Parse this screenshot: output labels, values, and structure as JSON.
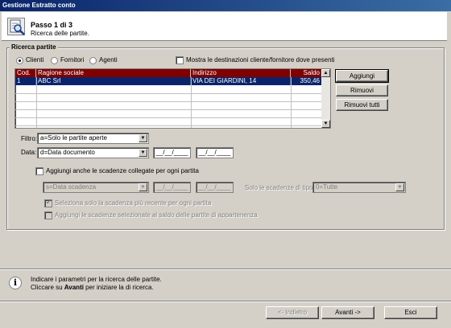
{
  "window": {
    "title": "Gestione Estratto conto"
  },
  "header": {
    "step": "Passo 1 di 3",
    "subtitle": "Ricerca delle partite.",
    "icon": "search-document-icon"
  },
  "group": {
    "title": "Ricerca partite"
  },
  "radios": {
    "clienti": "Clienti",
    "fornitori": "Fornitori",
    "agenti": "Agenti",
    "selected": "Clienti"
  },
  "checkbox_destinazioni": {
    "label": "Mostra le destinazioni cliente/fornitore dove presenti",
    "checked": false
  },
  "table": {
    "columns": [
      "Cod.",
      "Ragione sociale",
      "Indirizzo",
      "Saldo"
    ],
    "rows": [
      {
        "cod": "1",
        "ragione": "ABC Srl",
        "indirizzo": "VIA DEI GIARDINI, 14",
        "saldo": "350,46",
        "selected": true
      }
    ]
  },
  "buttons": {
    "aggiungi": "Aggiungi",
    "rimuovi": "Rimuovi",
    "rimuovi_tutti": "Rimuovi tutti"
  },
  "filtro": {
    "label": "Filtro:",
    "value": "a=Solo le partite aperte"
  },
  "data": {
    "label": "Data:",
    "value": "d=Data documento",
    "date_from": "__/__/____",
    "date_to": "__/__/____"
  },
  "scadenze": {
    "checkbox_label": "Aggiungi anche le scadenze collegate per ogni partita",
    "checked": false,
    "combo_value": "s=Data scadenza",
    "date_from": "__/__/____",
    "date_to": "__/__/____",
    "tipo_label": "Solo le scadenze di tipo:",
    "tipo_value": "0=Tutte",
    "opt_recente": "Seleziona solo la scadenza più recente per ogni partita",
    "opt_recente_checked": true,
    "opt_saldo": "Aggiungi le scadenze selezionate al saldo delle partite di appartenenza",
    "opt_saldo_checked": false
  },
  "footer": {
    "info_line1": "Indicare i parametri per la ricerca delle partite.",
    "info_line2_pre": "Cliccare su ",
    "info_line2_bold": "Avanti",
    "info_line2_post": " per iniziare la di ricerca.",
    "btn_back": "<- Indietro",
    "btn_next": "Avanti ->",
    "btn_exit": "Esci"
  },
  "colors": {
    "title_bar": "#0a246a",
    "grid_header": "#800000",
    "selection": "#0a246a",
    "face": "#d4d0c8"
  }
}
